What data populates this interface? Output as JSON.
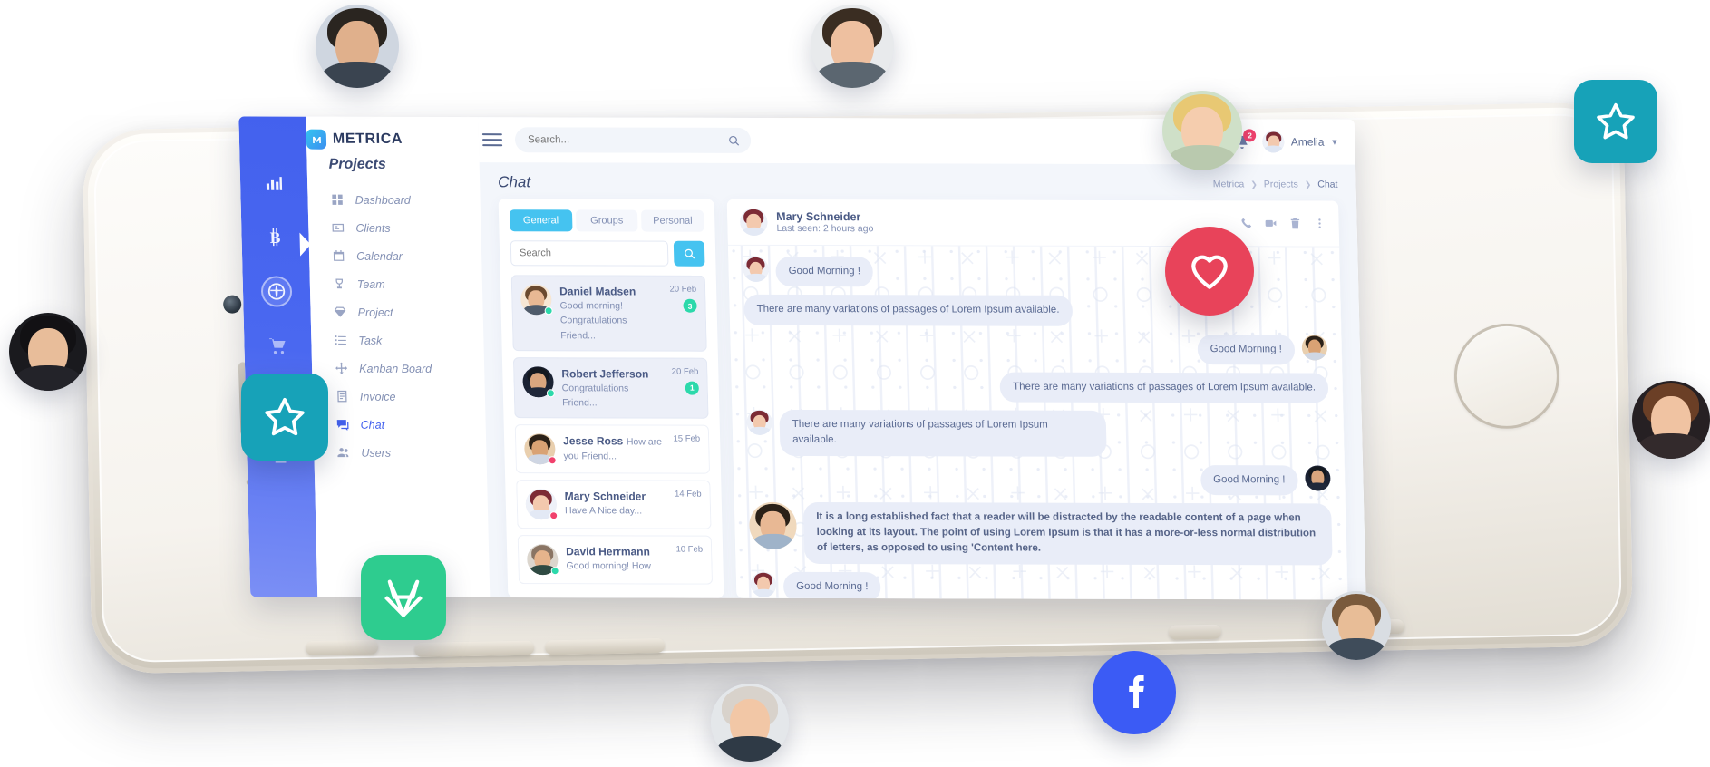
{
  "app": {
    "brand_name": "METRICA",
    "brand_mark": "m-logo-icon"
  },
  "header": {
    "menu_icon": "hamburger-icon",
    "search_placeholder": "Search...",
    "search_value": "",
    "search_icon": "search-icon",
    "bell_icon": "bell-icon",
    "notification_count": "2",
    "user_name": "Amelia",
    "caret_icon": "chevron-down-icon"
  },
  "sidebar": {
    "title": "Projects",
    "items": [
      {
        "label": "Dashboard",
        "icon": "grid-icon",
        "active": false
      },
      {
        "label": "Clients",
        "icon": "id-card-icon",
        "active": false
      },
      {
        "label": "Calendar",
        "icon": "calendar-icon",
        "active": false
      },
      {
        "label": "Team",
        "icon": "trophy-icon",
        "active": false
      },
      {
        "label": "Project",
        "icon": "diamond-icon",
        "active": false
      },
      {
        "label": "Task",
        "icon": "list-icon",
        "active": false
      },
      {
        "label": "Kanban Board",
        "icon": "move-icon",
        "active": false
      },
      {
        "label": "Invoice",
        "icon": "document-icon",
        "active": false
      },
      {
        "label": "Chat",
        "icon": "chat-icon",
        "active": true
      },
      {
        "label": "Users",
        "icon": "users-icon",
        "active": false
      }
    ]
  },
  "icon_rail": {
    "items": [
      {
        "icon": "bar-chart-icon",
        "active": false
      },
      {
        "icon": "bitcoin-icon",
        "active": false
      },
      {
        "icon": "globe-icon",
        "active": true
      },
      {
        "icon": "cart-icon",
        "active": false
      },
      {
        "icon": "pie-chart-icon",
        "active": false
      },
      {
        "icon": "lock-icon",
        "active": false
      }
    ]
  },
  "page": {
    "title": "Chat",
    "breadcrumb": [
      "Metrica",
      "Projects",
      "Chat"
    ]
  },
  "chat_list": {
    "tabs": [
      {
        "label": "General",
        "active": true
      },
      {
        "label": "Groups",
        "active": false
      },
      {
        "label": "Personal",
        "active": false
      }
    ],
    "search_placeholder": "Search",
    "search_value": "",
    "search_button_icon": "search-icon",
    "items": [
      {
        "name": "Daniel Madsen",
        "preview": "Good morning! Congratulations Friend...",
        "date": "20 Feb",
        "badge": "3",
        "status": "online",
        "unread": true
      },
      {
        "name": "Robert Jefferson",
        "preview": "Congratulations Friend...",
        "date": "20 Feb",
        "badge": "1",
        "status": "online",
        "unread": true
      },
      {
        "name": "Jesse Ross",
        "preview": "How are you Friend...",
        "date": "15 Feb",
        "badge": "",
        "status": "offline",
        "unread": false
      },
      {
        "name": "Mary Schneider",
        "preview": "Have A Nice day...",
        "date": "14 Feb",
        "badge": "",
        "status": "offline",
        "unread": false
      },
      {
        "name": "David Herrmann",
        "preview": "Good morning! How",
        "date": "10 Feb",
        "badge": "",
        "status": "online",
        "unread": false
      }
    ]
  },
  "conversation": {
    "contact_name": "Mary Schneider",
    "last_seen": "Last seen: 2 hours ago",
    "actions": [
      {
        "icon": "phone-icon"
      },
      {
        "icon": "video-camera-icon"
      },
      {
        "icon": "trash-icon"
      },
      {
        "icon": "more-vertical-icon"
      }
    ],
    "messages": [
      {
        "side": "left",
        "text": "Good Morning !",
        "avatar": true,
        "size": "small"
      },
      {
        "side": "left",
        "text": "There are many variations of passages of Lorem Ipsum available.",
        "avatar": false,
        "size": "small"
      },
      {
        "side": "right",
        "text": "Good Morning !",
        "avatar": true,
        "size": "small"
      },
      {
        "side": "right",
        "text": "There are many variations of passages of Lorem Ipsum available.",
        "avatar": false,
        "size": "small"
      },
      {
        "side": "left",
        "text": "There are many variations of passages of Lorem Ipsum available.",
        "avatar": true,
        "size": "small"
      },
      {
        "side": "right",
        "text": "Good Morning !",
        "avatar": true,
        "size": "small"
      },
      {
        "side": "left",
        "text": "It is a long established fact that a reader will be distracted by the readable content of a page when looking at its layout. The point of using Lorem Ipsum is that it has a more-or-less normal distribution of letters, as opposed to using 'Content here.",
        "avatar": true,
        "size": "big"
      },
      {
        "side": "left",
        "text": "Good Morning !",
        "avatar": true,
        "size": "small"
      }
    ]
  },
  "stickers": {
    "star_tile_top_right": {
      "icon": "star-icon",
      "color": "#17a2b8"
    },
    "star_tile_left": {
      "icon": "star-icon",
      "color": "#17a2b8"
    },
    "heart_badge": {
      "icon": "heart-icon",
      "color": "#e8435a"
    },
    "gitlab_tile": {
      "icon": "gitlab-icon",
      "color": "#2ecc8f"
    },
    "facebook_badge": {
      "icon": "facebook-icon",
      "color": "#3b5bf5"
    },
    "avatars": [
      "avatar-male-1",
      "avatar-male-2",
      "avatar-female-blonde",
      "avatar-female-asian",
      "avatar-female-brunette",
      "avatar-male-beard",
      "avatar-female-short-hair"
    ]
  },
  "colors": {
    "brand_blue": "#4361ee",
    "accent_cyan": "#45c3f0",
    "green": "#2cd9ab",
    "red": "#f1416c",
    "text_dark": "#3b4a73",
    "text_muted": "#8390b4",
    "panel_bg": "#f3f6fb"
  }
}
